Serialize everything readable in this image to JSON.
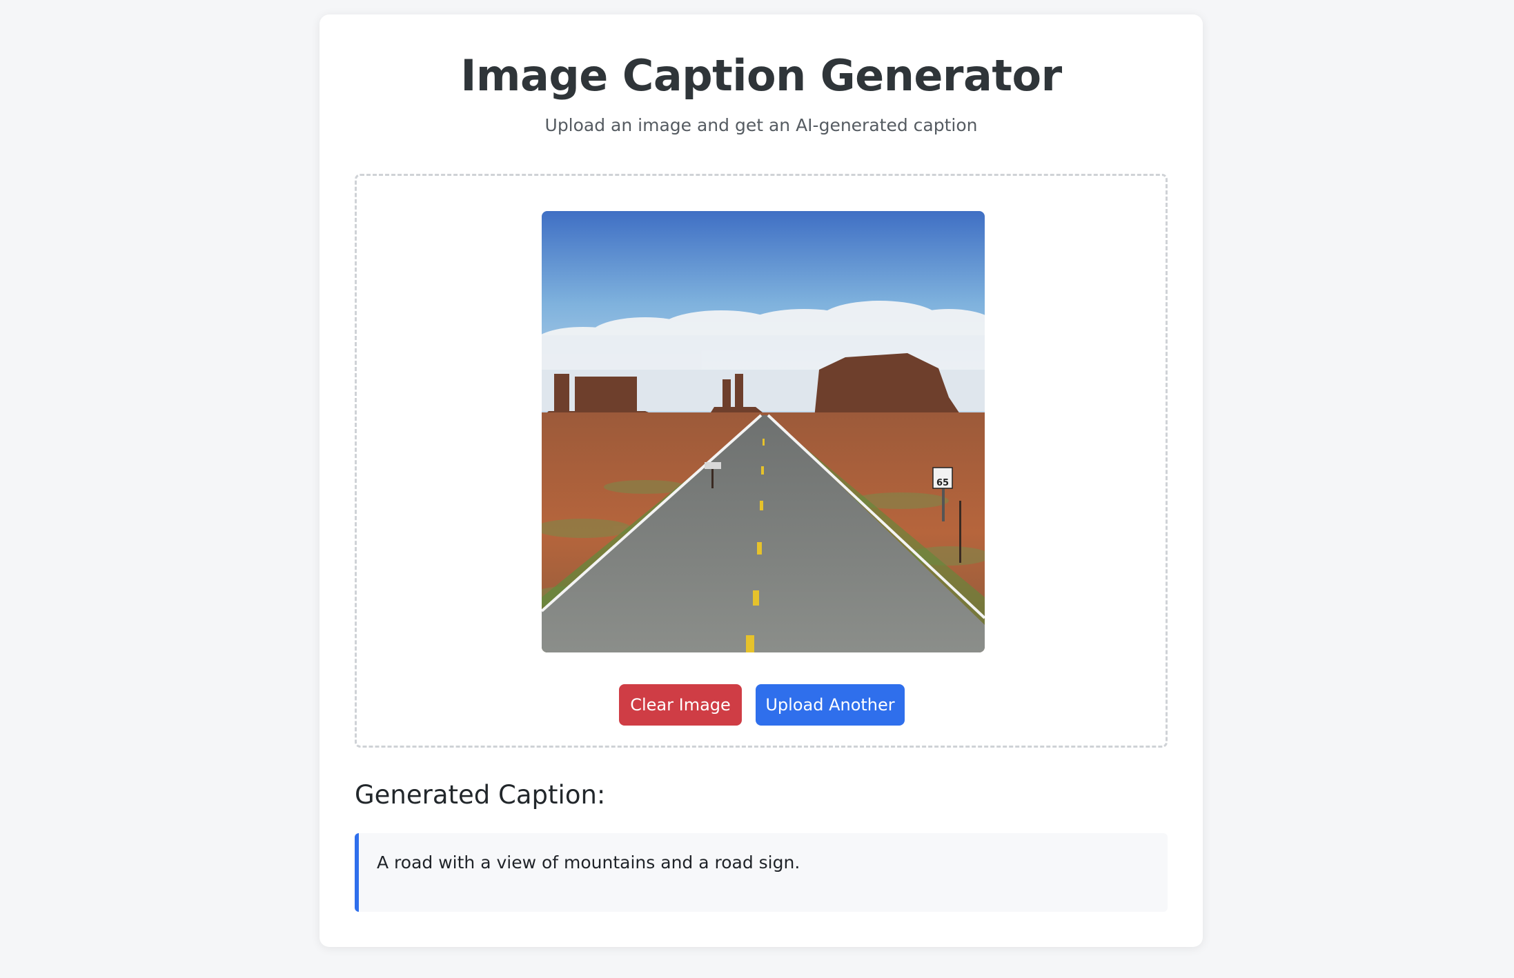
{
  "header": {
    "title": "Image Caption Generator",
    "subtitle": "Upload an image and get an AI-generated caption"
  },
  "upload": {
    "preview_alt": "desert road landscape photo",
    "sign_text": "65",
    "clear_label": "Clear Image",
    "upload_label": "Upload Another"
  },
  "result": {
    "heading": "Generated Caption:",
    "caption": "A road with a view of mountains and a road sign."
  },
  "colors": {
    "accent": "#2f6fec",
    "danger": "#cf3d45"
  }
}
